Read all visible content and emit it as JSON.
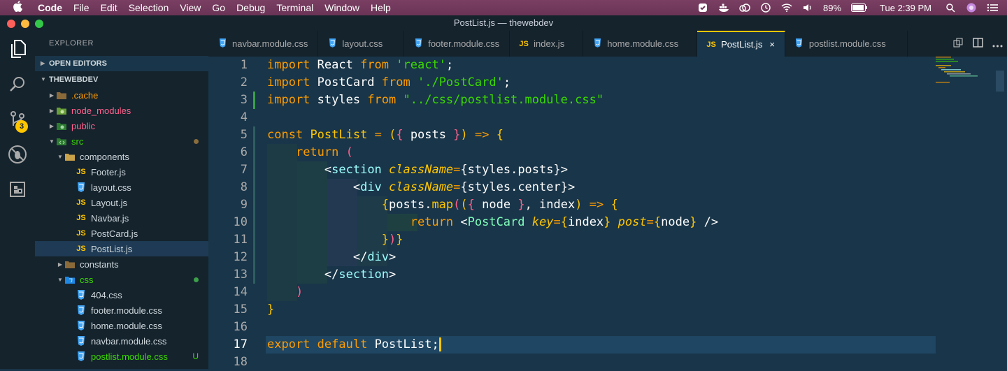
{
  "menubar": {
    "app": "Code",
    "items": [
      "File",
      "Edit",
      "Selection",
      "View",
      "Go",
      "Debug",
      "Terminal",
      "Window",
      "Help"
    ],
    "battery": "89%",
    "clock": "Tue 2:39 PM"
  },
  "window": {
    "title": "PostList.js — thewebdev"
  },
  "sidebar": {
    "title": "EXPLORER",
    "open_editors": "OPEN EDITORS",
    "workspace": "THEWEBDEV",
    "tree": [
      {
        "label": ".cache",
        "color": "#ff9d00"
      },
      {
        "label": "node_modules",
        "color": "#ff628c"
      },
      {
        "label": "public",
        "color": "#ff628c"
      },
      {
        "label": "src",
        "color": "#3ad900"
      },
      {
        "label": "components",
        "color": "#cfd8dc"
      },
      {
        "label": "Footer.js",
        "color": "#cfd8dc"
      },
      {
        "label": "layout.css",
        "color": "#cfd8dc"
      },
      {
        "label": "Layout.js",
        "color": "#cfd8dc"
      },
      {
        "label": "Navbar.js",
        "color": "#cfd8dc"
      },
      {
        "label": "PostCard.js",
        "color": "#cfd8dc"
      },
      {
        "label": "PostList.js",
        "color": "#cfd8dc"
      },
      {
        "label": "constants",
        "color": "#cfd8dc"
      },
      {
        "label": "css",
        "color": "#3ad900"
      },
      {
        "label": "404.css",
        "color": "#cfd8dc"
      },
      {
        "label": "footer.module.css",
        "color": "#cfd8dc"
      },
      {
        "label": "home.module.css",
        "color": "#cfd8dc"
      },
      {
        "label": "navbar.module.css",
        "color": "#cfd8dc"
      },
      {
        "label": "postlist.module.css",
        "color": "#3ad900"
      }
    ],
    "untracked_badge": "U",
    "scm_badge": "3"
  },
  "tabs": [
    {
      "label": "navbar.module.css",
      "type": "css"
    },
    {
      "label": "layout.css",
      "type": "css"
    },
    {
      "label": "footer.module.css",
      "type": "css"
    },
    {
      "label": "index.js",
      "type": "js"
    },
    {
      "label": "home.module.css",
      "type": "css"
    },
    {
      "label": "PostList.js",
      "type": "js",
      "active": true
    },
    {
      "label": "postlist.module.css",
      "type": "css"
    }
  ],
  "editor": {
    "line_numbers": [
      "1",
      "2",
      "3",
      "4",
      "5",
      "6",
      "7",
      "8",
      "9",
      "10",
      "11",
      "12",
      "13",
      "14",
      "15",
      "16",
      "17",
      "18"
    ],
    "current_line": 17
  },
  "icons": {
    "js_glyph": "JS",
    "close_tab": "×"
  },
  "colors": {
    "accent": "#ffc600",
    "background": "#193549",
    "sidebar": "#15232d",
    "keyword": "#ff9d00",
    "string": "#3ad900",
    "tag": "#9effff"
  }
}
